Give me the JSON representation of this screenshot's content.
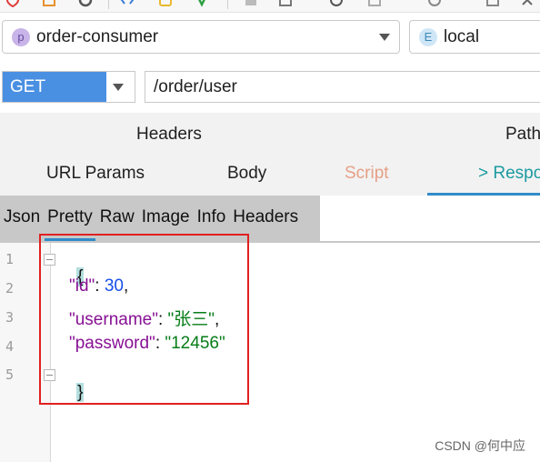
{
  "service_select": {
    "badge": "P",
    "value": "order-consumer",
    "badge_color": "#c8b4e8"
  },
  "env_select": {
    "badge": "E",
    "value": "local",
    "badge_color": "#cfe6f6"
  },
  "request": {
    "method": "GET",
    "url": "/order/user"
  },
  "tabs_top": {
    "headers": "Headers",
    "path": "Path"
  },
  "tabs_main": [
    {
      "label": "URL Params"
    },
    {
      "label": "Body"
    },
    {
      "label": "Script"
    },
    {
      "label": "> Respo"
    }
  ],
  "response_tabs": [
    "Json",
    "Pretty",
    "Raw",
    "Image",
    "Info",
    "Headers"
  ],
  "response_active": "Pretty",
  "code": {
    "line_numbers": [
      "1",
      "2",
      "3",
      "4",
      "5"
    ],
    "open_brace": "{",
    "close_brace": "}",
    "fields": [
      {
        "key": "\"id\"",
        "value": "30",
        "type": "number",
        "trail": ","
      },
      {
        "key": "\"username\"",
        "value": "\"张三\"",
        "type": "string",
        "trail": ","
      },
      {
        "key": "\"password\"",
        "value": "\"12456\"",
        "type": "string",
        "trail": ""
      }
    ]
  },
  "watermark": "CSDN @何中应",
  "colors": {
    "accent": "#4a90e2",
    "highlight_box": "#e02020",
    "active_tab": "#1a9aa1",
    "script_tab": "#e6a086"
  }
}
